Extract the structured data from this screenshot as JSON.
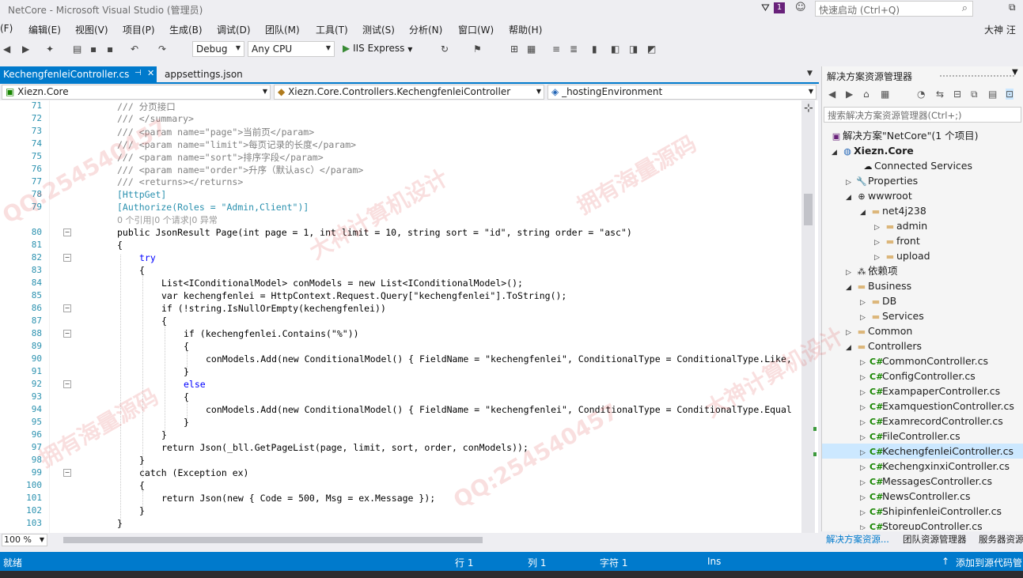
{
  "window": {
    "title": "NetCore - Microsoft Visual Studio (管理员)",
    "quick_launch_placeholder": "快速启动 (Ctrl+Q)",
    "notification_count": "1",
    "user": "大神 汪"
  },
  "menu": [
    "(F)",
    "编辑(E)",
    "视图(V)",
    "项目(P)",
    "生成(B)",
    "调试(D)",
    "团队(M)",
    "工具(T)",
    "测试(S)",
    "分析(N)",
    "窗口(W)",
    "帮助(H)"
  ],
  "toolbar": {
    "config": "Debug",
    "platform": "Any CPU",
    "run_target": "IIS Express"
  },
  "tabs": [
    {
      "label": "KechengfenleiController.cs",
      "active": true
    },
    {
      "label": "appsettings.json",
      "active": false
    }
  ],
  "navbar": {
    "project": "Xiezn.Core",
    "class": "Xiezn.Core.Controllers.KechengfenleiController",
    "member": "_hostingEnvironment"
  },
  "code": {
    "lines": [
      {
        "n": "71",
        "text": "/// 分页接口"
      },
      {
        "n": "72",
        "text": "/// </summary>"
      },
      {
        "n": "73",
        "text": "/// <param name=\"page\">当前页</param>"
      },
      {
        "n": "74",
        "text": "/// <param name=\"limit\">每页记录的长度</param>"
      },
      {
        "n": "75",
        "text": "/// <param name=\"sort\">排序字段</param>"
      },
      {
        "n": "76",
        "text": "/// <param name=\"order\">升序（默认asc）</param>"
      },
      {
        "n": "77",
        "text": "/// <returns></returns>"
      },
      {
        "n": "78",
        "text": "[HttpGet]"
      },
      {
        "n": "79",
        "text": "[Authorize(Roles = \"Admin,Client\")]"
      },
      {
        "n": "80",
        "text": "public JsonResult Page(int page = 1, int limit = 10, string sort = \"id\", string order = \"asc\")"
      },
      {
        "n": "81",
        "text": "{"
      },
      {
        "n": "82",
        "text": "try"
      },
      {
        "n": "83",
        "text": "{"
      },
      {
        "n": "84",
        "text": "List<IConditionalModel> conModels = new List<IConditionalModel>();"
      },
      {
        "n": "85",
        "text": "var kechengfenlei = HttpContext.Request.Query[\"kechengfenlei\"].ToString();"
      },
      {
        "n": "86",
        "text": "if (!string.IsNullOrEmpty(kechengfenlei))"
      },
      {
        "n": "87",
        "text": "{"
      },
      {
        "n": "88",
        "text": "if (kechengfenlei.Contains(\"%\"))"
      },
      {
        "n": "89",
        "text": "{"
      },
      {
        "n": "90",
        "text": "conModels.Add(new ConditionalModel() { FieldName = \"kechengfenlei\", ConditionalType = ConditionalType.Like,"
      },
      {
        "n": "91",
        "text": "}"
      },
      {
        "n": "92",
        "text": "else"
      },
      {
        "n": "93",
        "text": "{"
      },
      {
        "n": "94",
        "text": "conModels.Add(new ConditionalModel() { FieldName = \"kechengfenlei\", ConditionalType = ConditionalType.Equal"
      },
      {
        "n": "95",
        "text": "}"
      },
      {
        "n": "96",
        "text": "}"
      },
      {
        "n": "97",
        "text": "return Json(_bll.GetPageList(page, limit, sort, order, conModels));"
      },
      {
        "n": "98",
        "text": "}"
      },
      {
        "n": "99",
        "text": "catch (Exception ex)"
      },
      {
        "n": "100",
        "text": "{"
      },
      {
        "n": "101",
        "text": "return Json(new { Code = 500, Msg = ex.Message });"
      },
      {
        "n": "102",
        "text": "}"
      },
      {
        "n": "103",
        "text": "}"
      }
    ],
    "codelens": "0 个引用|0 个请求|0 异常"
  },
  "zoom": "100 %",
  "solution_explorer": {
    "title": "解决方案资源管理器",
    "search_placeholder": "搜索解决方案资源管理器(Ctrl+;)",
    "nodes": [
      {
        "label": "解决方案\"NetCore\"(1 个项目)",
        "icon": "solution-icon"
      },
      {
        "label": "Xiezn.Core",
        "icon": "web-project-icon"
      },
      {
        "label": "Connected Services",
        "icon": "connected-services-icon"
      },
      {
        "label": "Properties",
        "icon": "wrench-icon"
      },
      {
        "label": "wwwroot",
        "icon": "globe-icon"
      },
      {
        "label": "net4j238",
        "icon": "folder-icon"
      },
      {
        "label": "admin",
        "icon": "folder-icon"
      },
      {
        "label": "front",
        "icon": "folder-icon"
      },
      {
        "label": "upload",
        "icon": "folder-icon"
      },
      {
        "label": "依赖项",
        "icon": "dependencies-icon"
      },
      {
        "label": "Business",
        "icon": "folder-icon"
      },
      {
        "label": "DB",
        "icon": "folder-icon"
      },
      {
        "label": "Services",
        "icon": "folder-icon"
      },
      {
        "label": "Common",
        "icon": "folder-icon"
      },
      {
        "label": "Controllers",
        "icon": "folder-icon"
      },
      {
        "label": "CommonController.cs",
        "icon": "csharp-file-icon"
      },
      {
        "label": "ConfigController.cs",
        "icon": "csharp-file-icon"
      },
      {
        "label": "ExampaperController.cs",
        "icon": "csharp-file-icon"
      },
      {
        "label": "ExamquestionController.cs",
        "icon": "csharp-file-icon"
      },
      {
        "label": "ExamrecordController.cs",
        "icon": "csharp-file-icon"
      },
      {
        "label": "FileController.cs",
        "icon": "csharp-file-icon"
      },
      {
        "label": "KechengfenleiController.cs",
        "icon": "csharp-file-icon"
      },
      {
        "label": "KechengxinxiController.cs",
        "icon": "csharp-file-icon"
      },
      {
        "label": "MessagesController.cs",
        "icon": "csharp-file-icon"
      },
      {
        "label": "NewsController.cs",
        "icon": "csharp-file-icon"
      },
      {
        "label": "ShipinfenleiController.cs",
        "icon": "csharp-file-icon"
      },
      {
        "label": "StoreupController.cs",
        "icon": "csharp-file-icon"
      }
    ],
    "bottom_tabs": [
      "解决方案资源...",
      "团队资源管理器",
      "服务器资源"
    ]
  },
  "status": {
    "ready": "就绪",
    "row": "行 1",
    "col": "列 1",
    "char": "字符 1",
    "mode": "Ins",
    "source_control": "添加到源代码管"
  },
  "watermarks": [
    "QQ:254540457",
    "大神计算机设计",
    "拥有海量源码"
  ],
  "colors": {
    "accent": "#007acc",
    "keyword": "#0000ff",
    "type": "#2b91af",
    "string": "#a31515"
  }
}
